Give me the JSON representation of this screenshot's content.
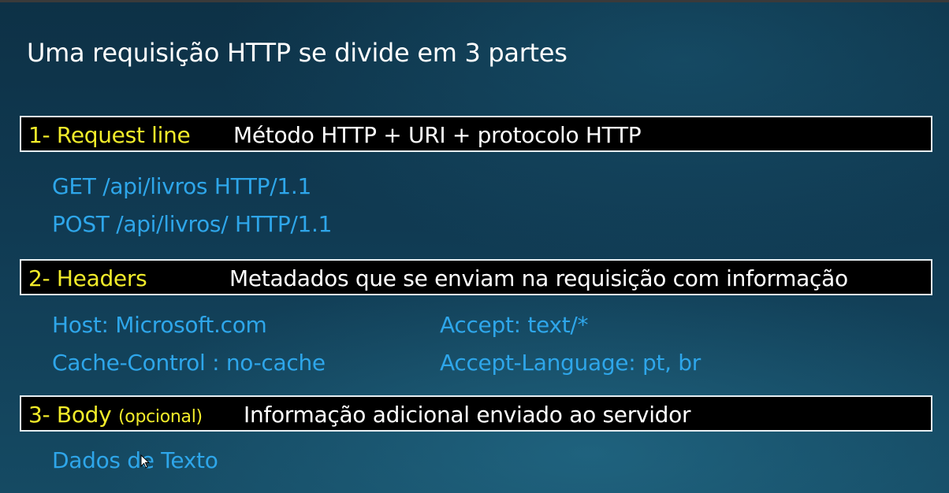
{
  "title": "Uma requisição HTTP se divide em 3 partes",
  "sections": [
    {
      "label": "1- Request line",
      "description": "Método HTTP   +  URI   +  protocolo HTTP",
      "lines": [
        "GET  /api/livros   HTTP/1.1",
        "POST  /api/livros/   HTTP/1.1"
      ]
    },
    {
      "label": "2- Headers",
      "description": "Metadados que se enviam na requisição com informação",
      "left_lines": [
        "Host: Microsoft.com",
        "Cache-Control : no-cache"
      ],
      "right_lines": [
        "Accept: text/*",
        "Accept-Language:  pt, br"
      ]
    },
    {
      "label": "3- Body",
      "label_note": "(opcional)",
      "description": "Informação adicional enviado ao servidor",
      "lines": [
        "Dados de Texto"
      ]
    }
  ],
  "colors": {
    "label": "#f2ec2a",
    "detail": "#2ea6ea",
    "bar_bg": "#000000",
    "text": "#ffffff"
  },
  "icons": {
    "pointer": "mouse-pointer-icon"
  }
}
